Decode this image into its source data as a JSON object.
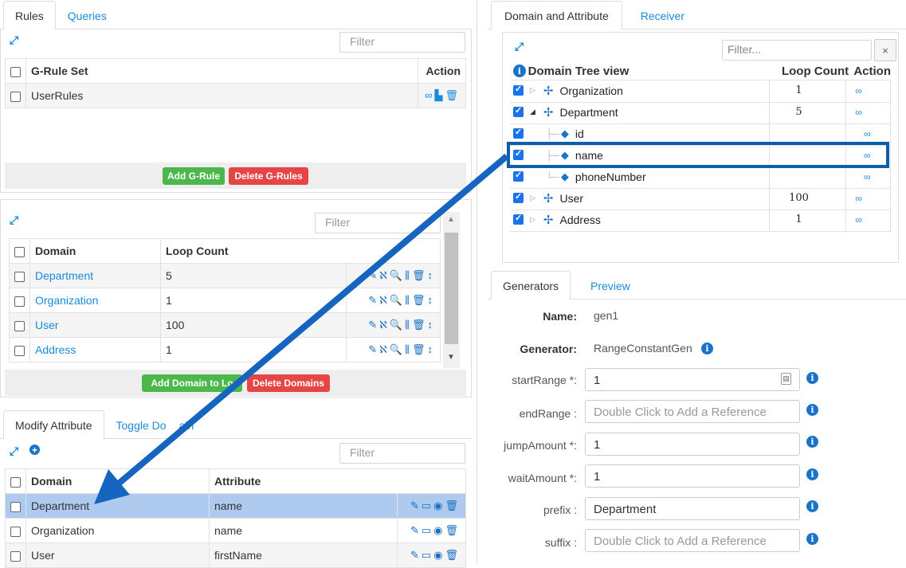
{
  "rules_panel": {
    "tabs": [
      "Rules",
      "Queries"
    ],
    "filter_placeholder": "Filter",
    "headers": {
      "name": "G-Rule Set",
      "action": "Action"
    },
    "rows": [
      {
        "name": "UserRules"
      }
    ],
    "buttons": {
      "add": "Add G-Rule",
      "delete": "Delete G-Rules"
    }
  },
  "domains_panel": {
    "filter_placeholder": "Filter",
    "headers": {
      "domain": "Domain",
      "loop": "Loop Count"
    },
    "rows": [
      {
        "domain": "Department",
        "loop": "5"
      },
      {
        "domain": "Organization",
        "loop": "1"
      },
      {
        "domain": "User",
        "loop": "100"
      },
      {
        "domain": "Address",
        "loop": "1"
      }
    ],
    "buttons": {
      "add": "Add Domain to Lo",
      "delete": "Delete Domains"
    }
  },
  "modify_panel": {
    "tabs": [
      "Modify Attribute",
      "Toggle Do",
      "ain"
    ],
    "filter_placeholder": "Filter",
    "headers": {
      "domain": "Domain",
      "attribute": "Attribute"
    },
    "rows": [
      {
        "domain": "Department",
        "attribute": "name"
      },
      {
        "domain": "Organization",
        "attribute": "name"
      },
      {
        "domain": "User",
        "attribute": "firstName"
      }
    ]
  },
  "domain_tree_panel": {
    "tabs": [
      "Domain and Attribute",
      "Receiver"
    ],
    "filter_placeholder": "Filter...",
    "clear_label": "×",
    "headers": {
      "tree": "Domain Tree view",
      "loop": "Loop Count",
      "action": "Action"
    },
    "rows": [
      {
        "label": "Organization",
        "loop": "1"
      },
      {
        "label": "Department",
        "loop": "5"
      },
      {
        "label": "id",
        "loop": ""
      },
      {
        "label": "name",
        "loop": ""
      },
      {
        "label": "phoneNumber",
        "loop": ""
      },
      {
        "label": "User",
        "loop": "100"
      },
      {
        "label": "Address",
        "loop": "1"
      }
    ]
  },
  "generators_panel": {
    "tabs": [
      "Generators",
      "Preview"
    ],
    "name_label": "Name:",
    "name_value": "gen1",
    "generator_label": "Generator:",
    "generator_value": "RangeConstantGen",
    "fields": [
      {
        "label": "startRange *:",
        "value": "1"
      },
      {
        "label": "endRange :",
        "value": "Double Click to Add a Reference"
      },
      {
        "label": "jumpAmount *:",
        "value": "1"
      },
      {
        "label": "waitAmount *:",
        "value": "1"
      },
      {
        "label": "prefix :",
        "value": "Department"
      },
      {
        "label": "suffix :",
        "value": "Double Click to Add a Reference"
      }
    ]
  },
  "colors": {
    "accent": "#1a8bd8",
    "highlight_border": "#0a5fa8",
    "arrow": "#1565c0",
    "selected_row": "#aecbef"
  }
}
